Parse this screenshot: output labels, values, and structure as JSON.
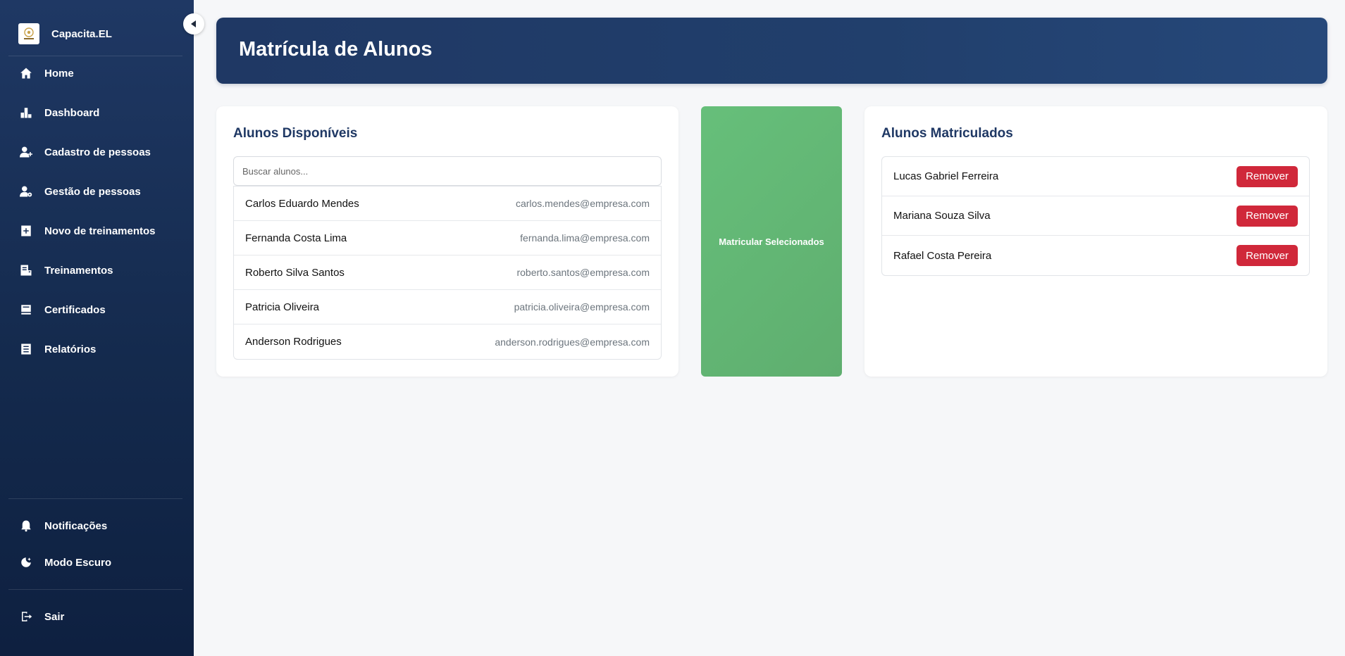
{
  "app": {
    "name": "Capacita.EL"
  },
  "sidebar": {
    "items": [
      {
        "label": "Home",
        "icon": "home-icon"
      },
      {
        "label": "Dashboard",
        "icon": "bar-chart-icon"
      },
      {
        "label": "Cadastro de pessoas",
        "icon": "user-plus-icon"
      },
      {
        "label": "Gestão de pessoas",
        "icon": "user-gear-icon"
      },
      {
        "label": "Novo de treinamentos",
        "icon": "add-file-icon"
      },
      {
        "label": "Treinamentos",
        "icon": "book-icon"
      },
      {
        "label": "Certificados",
        "icon": "certificate-icon"
      },
      {
        "label": "Relatórios",
        "icon": "report-icon"
      }
    ],
    "bottom": [
      {
        "label": "Notificações",
        "icon": "bell-icon"
      },
      {
        "label": "Modo Escuro",
        "icon": "moon-icon"
      }
    ],
    "logout": {
      "label": "Sair",
      "icon": "logout-icon"
    }
  },
  "header": {
    "title": "Matrícula de Alunos"
  },
  "available": {
    "title": "Alunos Disponíveis",
    "search_placeholder": "Buscar alunos...",
    "students": [
      {
        "name": "Carlos Eduardo Mendes",
        "email": "carlos.mendes@empresa.com"
      },
      {
        "name": "Fernanda Costa Lima",
        "email": "fernanda.lima@empresa.com"
      },
      {
        "name": "Roberto Silva Santos",
        "email": "roberto.santos@empresa.com"
      },
      {
        "name": "Patricia Oliveira",
        "email": "patricia.oliveira@empresa.com"
      },
      {
        "name": "Anderson Rodrigues",
        "email": "anderson.rodrigues@empresa.com"
      }
    ]
  },
  "enroll_button": {
    "label": "Matricular Selecionados"
  },
  "enrolled": {
    "title": "Alunos Matriculados",
    "remove_label": "Remover",
    "students": [
      {
        "name": "Lucas Gabriel Ferreira"
      },
      {
        "name": "Mariana Souza Silva"
      },
      {
        "name": "Rafael Costa Pereira"
      }
    ]
  },
  "colors": {
    "sidebar_bg": "#1a3159",
    "header_bg": "#1f3864",
    "enroll_green": "#64b877",
    "remove_red": "#d0283a",
    "title_blue": "#1f3864"
  }
}
